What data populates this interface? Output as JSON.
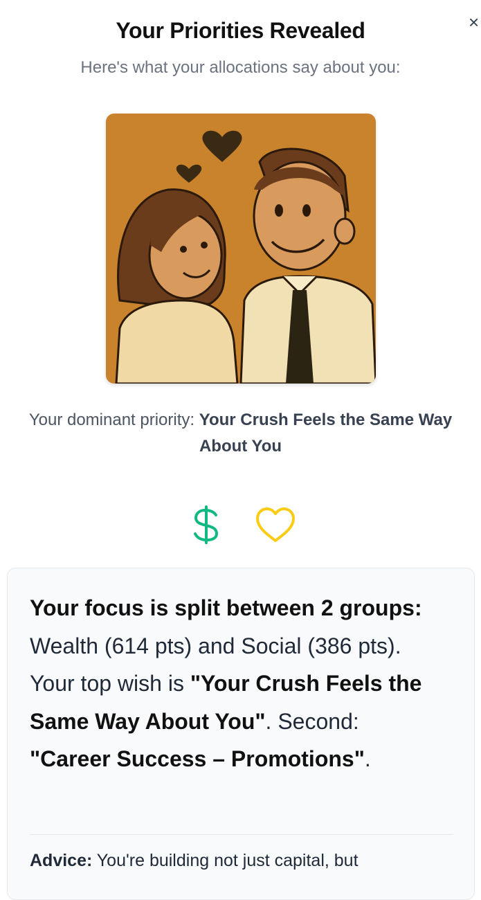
{
  "header": {
    "title": "Your Priorities Revealed",
    "subtitle": "Here's what your allocations say about you:",
    "close_label": "×"
  },
  "illustration": {
    "description_icon": "couple-illustration",
    "background_color": "#c9832c"
  },
  "dominant": {
    "prefix": "Your dominant priority: ",
    "value": "Your Crush Feels the Same Way About You"
  },
  "category_icons": [
    {
      "name": "dollar-icon",
      "glyph": "$",
      "color": "#10b981"
    },
    {
      "name": "heart-icon",
      "color": "#facc15"
    }
  ],
  "summary": {
    "lead_bold": "Your focus is split between 2 groups:",
    "text_1": " Wealth (614 pts) and Social (386 pts). Your top wish is ",
    "top_wish": "\"Your Crush Feels the Same Way About You\"",
    "text_2": ". Second: ",
    "second_wish": "\"Career Success – Promotions\"",
    "text_3": "."
  },
  "advice": {
    "label": "Advice:",
    "text": " You're building not just capital, but"
  }
}
